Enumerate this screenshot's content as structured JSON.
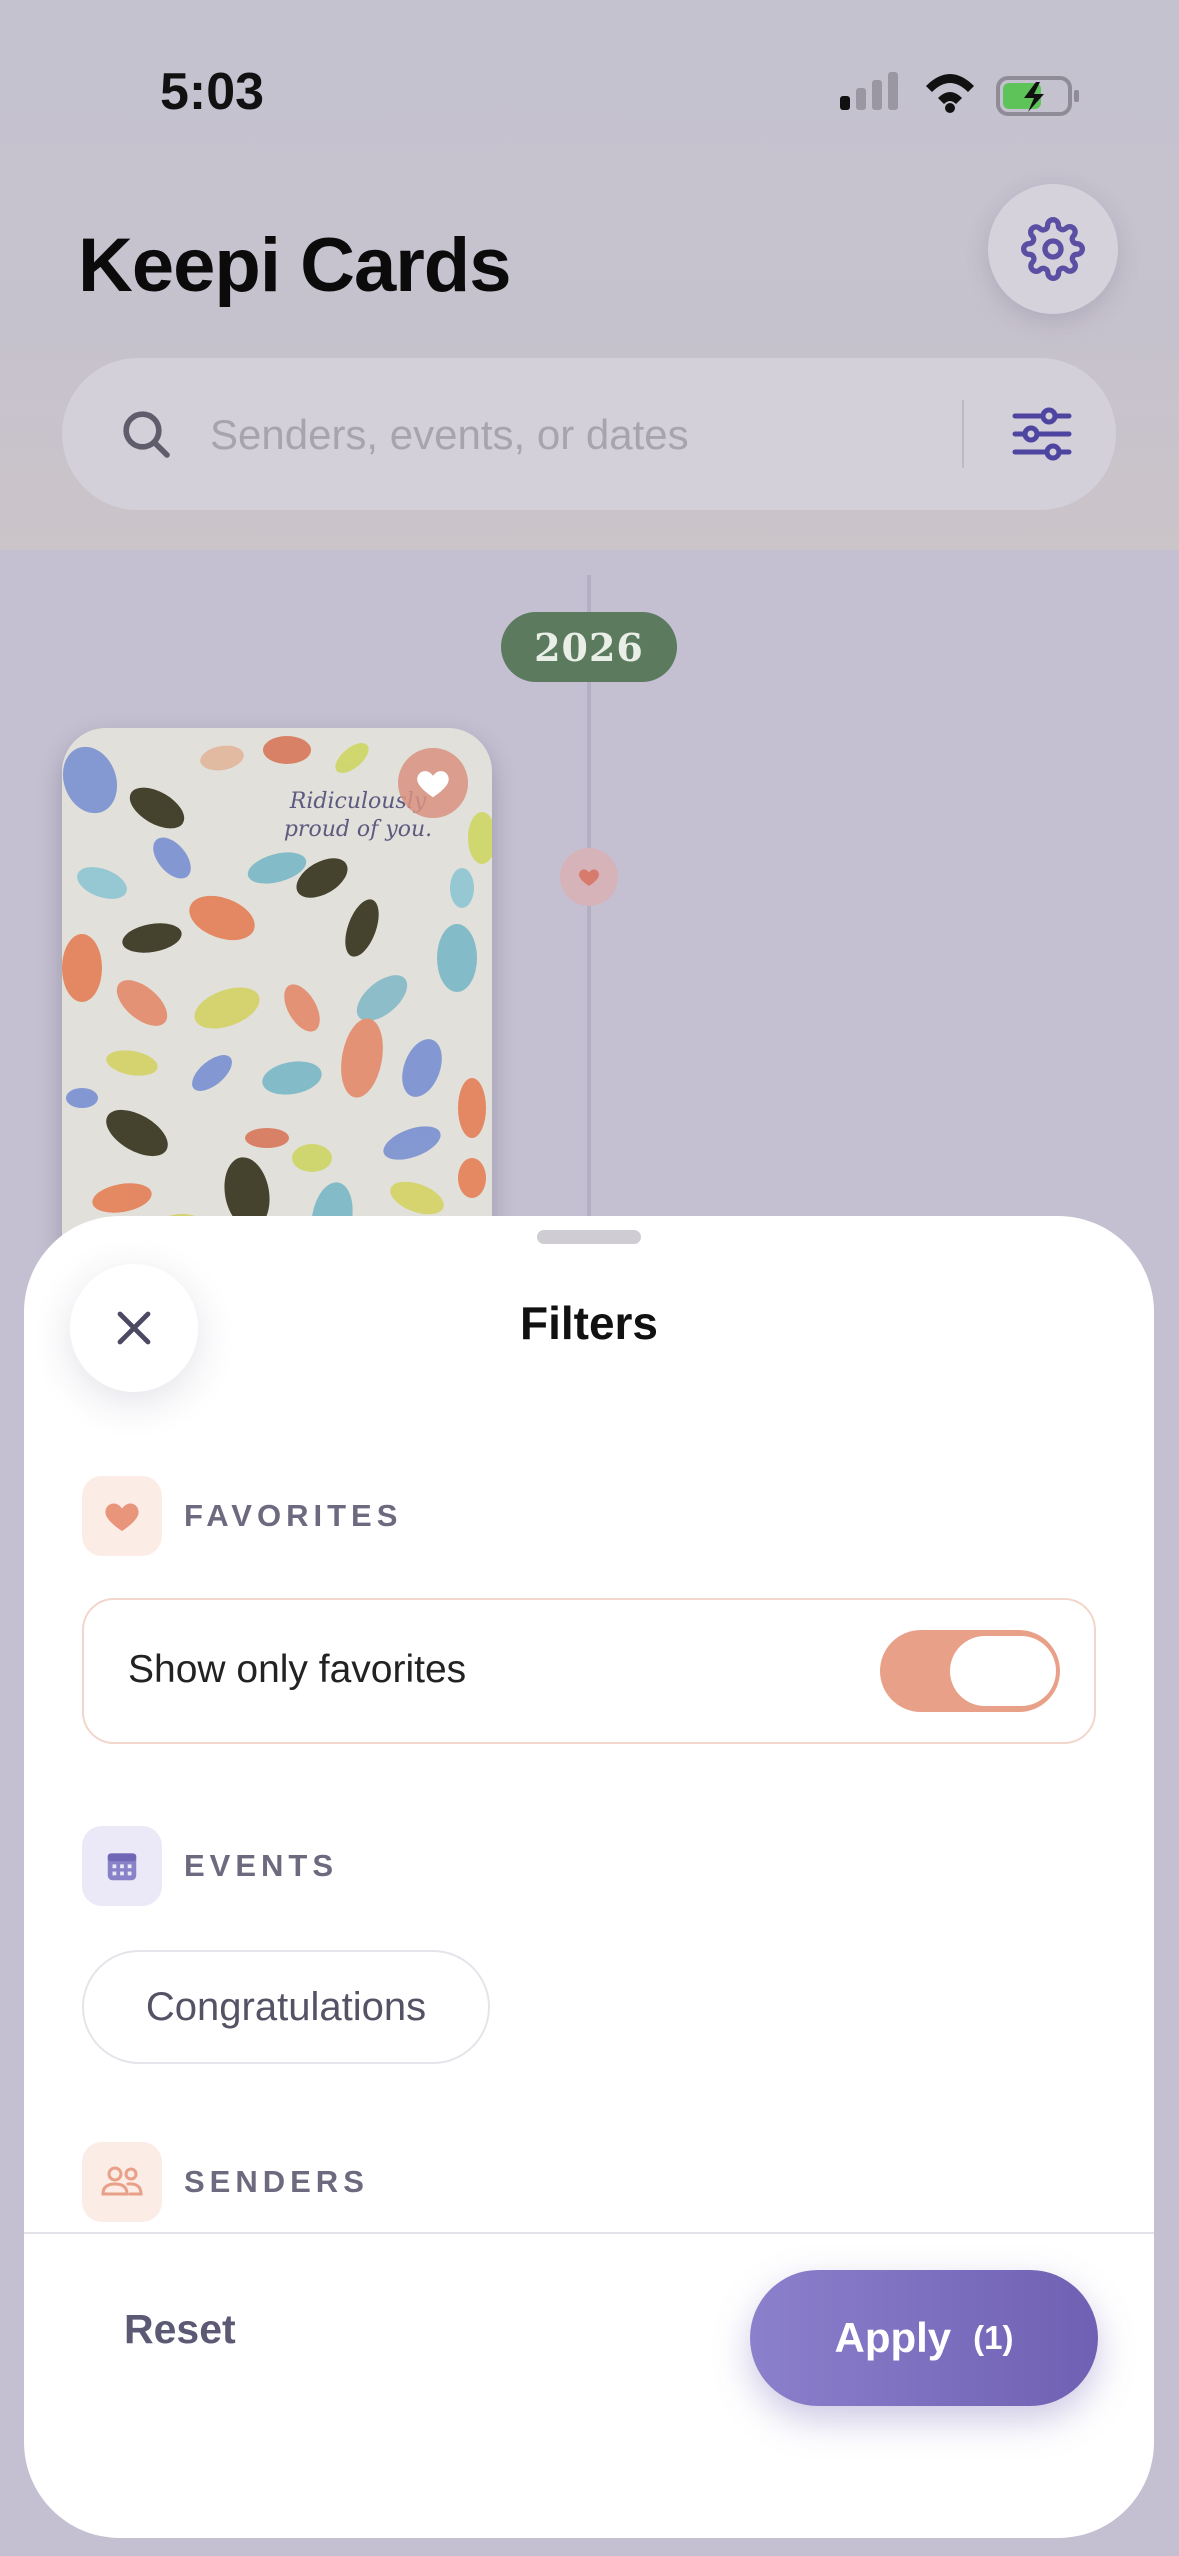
{
  "status_bar": {
    "time": "5:03"
  },
  "header": {
    "title": "Keepi Cards"
  },
  "search": {
    "placeholder": "Senders, events, or dates"
  },
  "timeline": {
    "year": "2026"
  },
  "card": {
    "text": "Ridiculously proud of you."
  },
  "sheet": {
    "title": "Filters",
    "favorites": {
      "section_label": "FAVORITES",
      "toggle_label": "Show only favorites",
      "toggle_on": true
    },
    "events": {
      "section_label": "EVENTS",
      "chips": [
        "Congratulations"
      ]
    },
    "senders": {
      "section_label": "SENDERS"
    },
    "footer": {
      "reset_label": "Reset",
      "apply_label": "Apply",
      "apply_count": "(1)"
    }
  },
  "colors": {
    "accent_purple": "#7466b8",
    "toggle_on": "#e8a188",
    "year_badge": "#5b7a5e"
  }
}
